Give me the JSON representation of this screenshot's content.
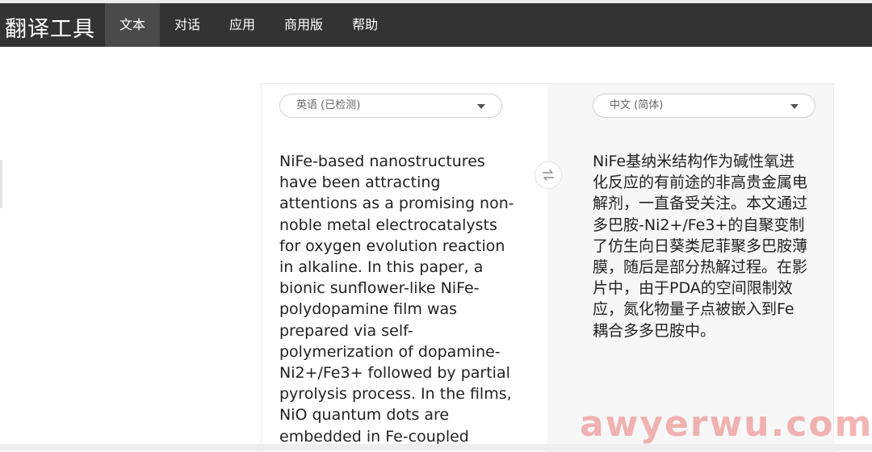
{
  "header": {
    "brand": "翻译工具",
    "nav": [
      {
        "label": "文本"
      },
      {
        "label": "对话"
      },
      {
        "label": "应用"
      },
      {
        "label": "商用版"
      },
      {
        "label": "帮助"
      }
    ]
  },
  "source": {
    "language": "英语 (已检测)",
    "lines": [
      "NiFe-based nanostructures",
      "have been attracting",
      "attentions as a promising non-",
      "noble metal electrocatalysts",
      "for oxygen evolution reaction",
      "in alkaline. In this paper, a",
      "bionic sunflower-like NiFe-",
      "polydopamine film was",
      "prepared via self-",
      "polymerization of dopamine-",
      "Ni2+/Fe3+ followed by partial",
      "pyrolysis process. In the films,",
      "NiO quantum dots are",
      "embedded in Fe-coupled"
    ]
  },
  "target": {
    "language": "中文 (简体)",
    "lines": [
      "NiFe基纳米结构作为碱性氧进",
      "化反应的有前途的非高贵金属电",
      "解剂，一直备受关注。本文通过",
      "多巴胺-Ni2+/Fe3+的自聚变制",
      "了仿生向日葵类尼菲聚多巴胺薄",
      "膜，随后是部分热解过程。在影",
      "片中，由于PDA的空间限制效",
      "应，氮化物量子点被嵌入到Fe",
      "耦合多多巴胺中。"
    ]
  },
  "watermark": "awyerwu.com",
  "icons": {
    "swap": "swap-arrows-icon",
    "dropdown": "chevron-down-icon"
  },
  "colors": {
    "topbar": "#333333",
    "active_tab": "#4a4a4a",
    "target_panel": "#f7f7f7",
    "watermark": "#eb7878"
  }
}
